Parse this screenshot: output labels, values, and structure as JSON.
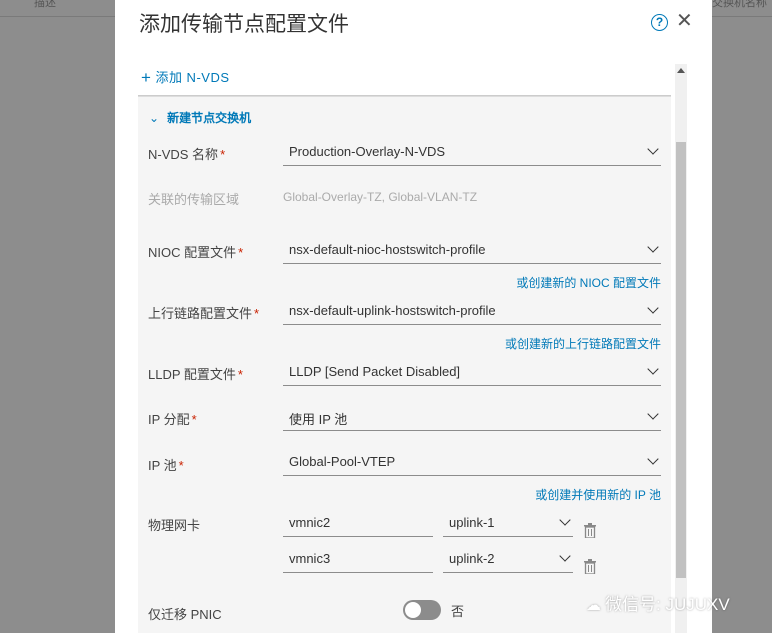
{
  "background": {
    "left_header": "描述",
    "right_header": "交换机名称"
  },
  "dialog": {
    "title": "添加传输节点配置文件",
    "help_glyph": "?",
    "close_glyph": "✕",
    "add_nvds": {
      "plus": "+",
      "label": "添加 N-VDS"
    },
    "section": {
      "chevron": "⌄",
      "title": "新建节点交换机"
    },
    "fields": {
      "nvds_name": {
        "label": "N-VDS 名称",
        "required": "*",
        "value": "Production-Overlay-N-VDS"
      },
      "transport_zone": {
        "label": "关联的传输区域",
        "value": "Global-Overlay-TZ, Global-VLAN-TZ"
      },
      "nioc": {
        "label": "NIOC 配置文件",
        "required": "*",
        "value": "nsx-default-nioc-hostswitch-profile",
        "link": "或创建新的 NIOC 配置文件"
      },
      "uplink": {
        "label": "上行链路配置文件",
        "required": "*",
        "value": "nsx-default-uplink-hostswitch-profile",
        "link": "或创建新的上行链路配置文件"
      },
      "lldp": {
        "label": "LLDP 配置文件",
        "required": "*",
        "value": "LLDP [Send Packet Disabled]"
      },
      "ip_assign": {
        "label": "IP 分配",
        "required": "*",
        "value": "使用 IP 池"
      },
      "ip_pool": {
        "label": "IP 池",
        "required": "*",
        "value": "Global-Pool-VTEP",
        "link": "或创建并使用新的 IP 池"
      },
      "pnic": {
        "label": "物理网卡",
        "rows": [
          {
            "nic": "vmnic2",
            "uplink": "uplink-1"
          },
          {
            "nic": "vmnic3",
            "uplink": "uplink-2"
          }
        ]
      },
      "migrate_pnic": {
        "label": "仅迁移 PNIC",
        "toggle_value": "否"
      }
    }
  },
  "watermark": {
    "icon": "☁",
    "text": "微信号: JUJUXV"
  },
  "colors": {
    "link": "#0079b8",
    "required": "#c92100",
    "overlay": "#8a8a8a"
  }
}
